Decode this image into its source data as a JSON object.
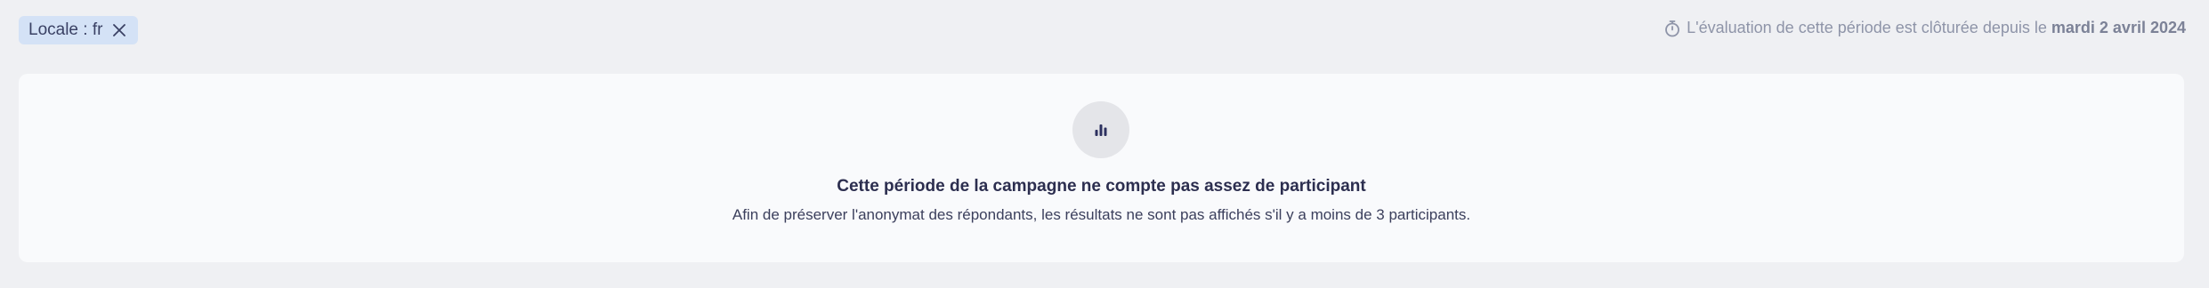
{
  "filter_chip": {
    "label": "Locale : fr",
    "remove_icon": "close-icon"
  },
  "closed_notice": {
    "icon": "stopwatch-icon",
    "text": "L'évaluation de cette période est clôturée depuis le",
    "date": "mardi 2 avril 2024"
  },
  "empty_state": {
    "icon": "bar-chart-icon",
    "title": "Cette période de la campagne ne compte pas assez de participant",
    "description": "Afin de préserver l'anonymat des répondants, les résultats ne sont pas affichés s'il y a moins de 3 participants."
  },
  "colors": {
    "background": "#eff0f3",
    "card": "#f9fafc",
    "chip": "#d4e2f6",
    "text_primary": "#2c2e4f",
    "text_muted": "#8e94a8"
  }
}
